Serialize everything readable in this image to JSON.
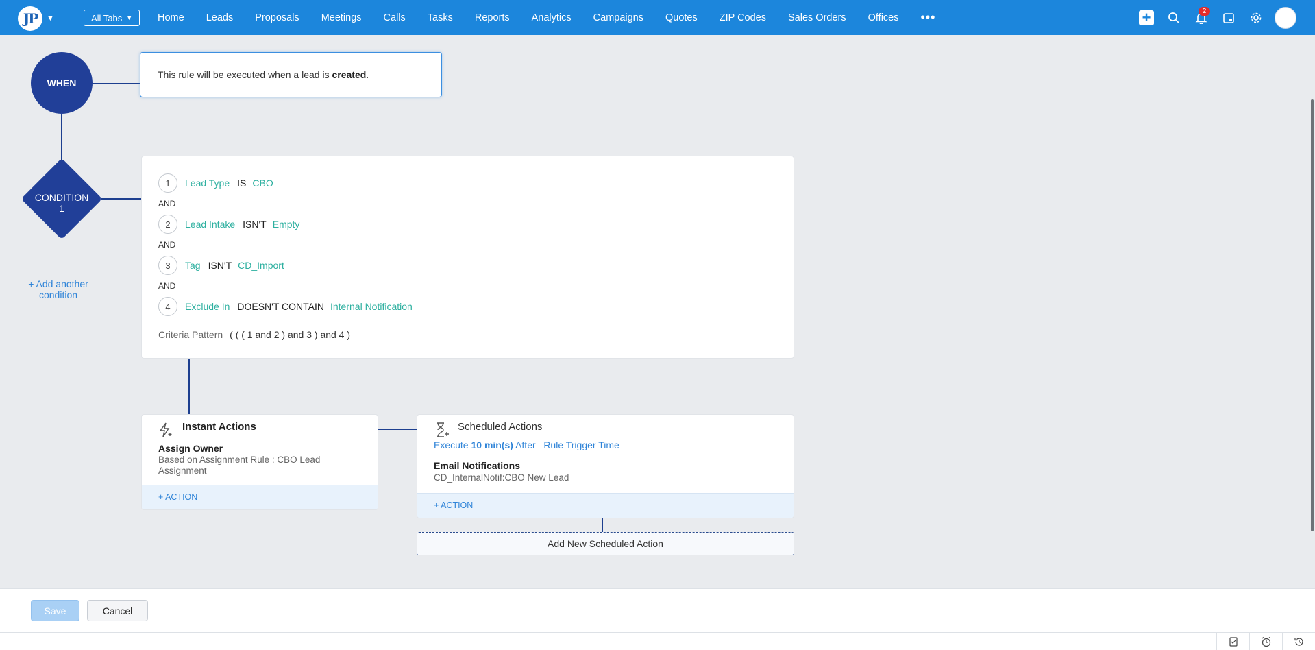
{
  "topbar": {
    "logo_text": "JP",
    "all_tabs_label": "All Tabs",
    "nav": [
      "Home",
      "Leads",
      "Proposals",
      "Meetings",
      "Calls",
      "Tasks",
      "Reports",
      "Analytics",
      "Campaigns",
      "Quotes",
      "ZIP Codes",
      "Sales Orders",
      "Offices"
    ],
    "notification_count": "2",
    "icons": [
      "create-icon",
      "search-icon",
      "bell-icon",
      "calendar-icon",
      "gear-icon",
      "avatar"
    ]
  },
  "flow": {
    "when_label": "WHEN",
    "when_text_prefix": "This rule will be executed when a lead is ",
    "when_text_bold": "created",
    "when_text_suffix": ".",
    "condition_label_line1": "CONDITION",
    "condition_label_line2": "1",
    "add_condition_line1": "+ Add another",
    "add_condition_line2": "condition",
    "criteria": [
      {
        "num": "1",
        "field": "Lead Type",
        "op": "IS",
        "value": "CBO"
      },
      {
        "num": "2",
        "field": "Lead Intake",
        "op": "ISN'T",
        "value": "Empty"
      },
      {
        "num": "3",
        "field": "Tag",
        "op": "ISN'T",
        "value": "CD_Import"
      },
      {
        "num": "4",
        "field": "Exclude In",
        "op": "DOESN'T CONTAIN",
        "value": "Internal Notification"
      }
    ],
    "and_label": "AND",
    "criteria_pattern_label": "Criteria Pattern",
    "criteria_pattern_value": "( ( ( 1 and 2 ) and 3 ) and 4 )"
  },
  "instant_actions": {
    "title": "Instant Actions",
    "item_title": "Assign Owner",
    "item_desc_line1": "Based on Assignment Rule : CBO Lead",
    "item_desc_line2": "Assignment",
    "add_action": "+ ACTION"
  },
  "scheduled_actions": {
    "title": "Scheduled Actions",
    "exec_prefix": "Execute ",
    "exec_bold": "10 min(s)",
    "exec_after": " After",
    "exec_trigger": "Rule Trigger Time",
    "item_title": "Email Notifications",
    "item_desc": "CD_InternalNotif:CBO New Lead",
    "add_action": "+ ACTION",
    "add_new": "Add New Scheduled Action"
  },
  "footer": {
    "save": "Save",
    "cancel": "Cancel"
  }
}
